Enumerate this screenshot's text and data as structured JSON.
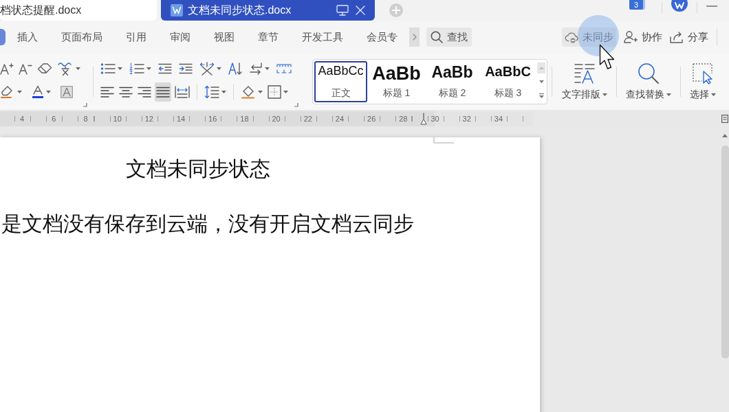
{
  "file_tabs": [
    {
      "label": "档状态提醒.docx",
      "selected": false
    },
    {
      "label": "文档未同步状态.docx",
      "selected": true
    }
  ],
  "window_badge": "3",
  "ribbon_tabs": [
    {
      "selected": true
    },
    {
      "label": "插入",
      "selected": false
    },
    {
      "label": "页面布局",
      "selected": false
    },
    {
      "label": "引用",
      "selected": false
    },
    {
      "label": "审阅",
      "selected": false
    },
    {
      "label": "视图",
      "selected": false
    },
    {
      "label": "章节",
      "selected": false
    },
    {
      "label": "开发工具",
      "selected": false
    },
    {
      "label": "会员专",
      "selected": false
    }
  ],
  "find_button": {
    "label": "查找"
  },
  "sync_status": {
    "label": "未同步"
  },
  "share_actions": [
    {
      "kind": "collaborate",
      "label": "协作"
    },
    {
      "kind": "share",
      "label": "分享"
    }
  ],
  "paragraph_alignment": [
    {
      "kind": "left",
      "selected": false
    },
    {
      "kind": "center",
      "selected": false
    },
    {
      "kind": "right",
      "selected": false
    },
    {
      "kind": "justify",
      "selected": true
    },
    {
      "kind": "distributed",
      "selected": false
    }
  ],
  "style_gallery": [
    {
      "kind": "normal",
      "preview": "AaBbCc",
      "label": "正文",
      "selected": true
    },
    {
      "kind": "heading1",
      "preview": "AaBb",
      "label": "标题 1",
      "selected": false
    },
    {
      "kind": "heading2",
      "preview": "AaBb",
      "label": "标题 2",
      "selected": false
    },
    {
      "kind": "heading3",
      "preview": "AaBbC",
      "label": "标题 3",
      "selected": false
    }
  ],
  "big_tools": [
    {
      "kind": "text-layout",
      "label": "文字排版"
    },
    {
      "kind": "find-replace",
      "label": "查找替换"
    },
    {
      "kind": "select",
      "label": "选择"
    }
  ],
  "ruler": {
    "labels": [
      "4",
      "6",
      "8",
      "10",
      "12",
      "14",
      "16",
      "18",
      "20",
      "22",
      "24",
      "26",
      "28",
      "30",
      "32",
      "34"
    ]
  },
  "document": {
    "title": "文档未同步状态",
    "body": "是文档没有保存到云端，没有开启文档云同步"
  }
}
